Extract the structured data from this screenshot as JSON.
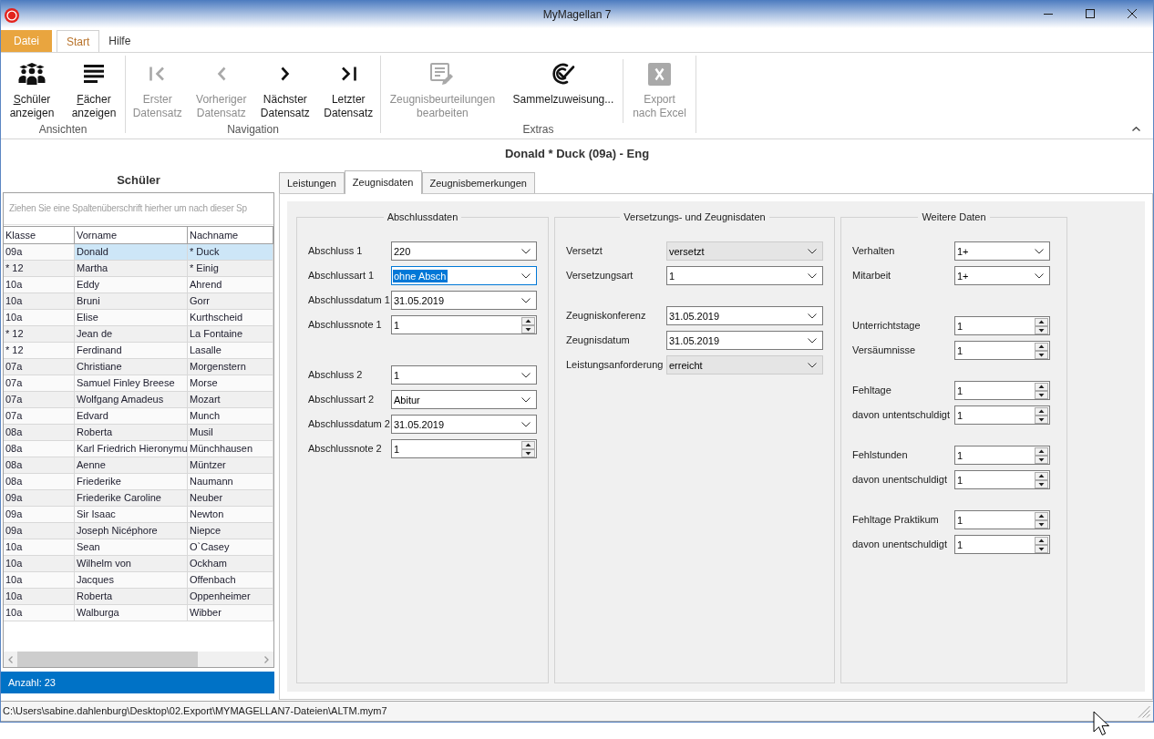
{
  "window": {
    "title": "MyMagellan 7"
  },
  "ribbon_tabs": [
    {
      "label": "Datei",
      "kind": "file",
      "selected": false
    },
    {
      "label": "Start",
      "kind": "tab",
      "selected": true
    },
    {
      "label": "Hilfe",
      "kind": "tab",
      "selected": false
    }
  ],
  "ribbon_groups": [
    {
      "label": "Ansichten",
      "sections": [
        {
          "buttons": [
            {
              "lines": [
                "Schüler",
                "anzeigen"
              ],
              "disabled": false,
              "access_key_underlined": true
            },
            {
              "lines": [
                "Fächer",
                "anzeigen"
              ],
              "disabled": false,
              "access_key_underlined": true
            }
          ]
        }
      ]
    },
    {
      "label": "Navigation",
      "sections": [
        {
          "buttons": [
            {
              "lines": [
                "Erster",
                "Datensatz"
              ],
              "disabled": true,
              "access_key_underlined": false
            },
            {
              "lines": [
                "Vorheriger",
                "Datensatz"
              ],
              "disabled": true,
              "access_key_underlined": false
            },
            {
              "lines": [
                "Nächster",
                "Datensatz"
              ],
              "disabled": false,
              "access_key_underlined": false
            },
            {
              "lines": [
                "Letzter",
                "Datensatz"
              ],
              "disabled": false,
              "access_key_underlined": false
            }
          ]
        }
      ]
    },
    {
      "label": "Extras",
      "sections": [
        {
          "buttons": [
            {
              "lines": [
                "Zeugnisbeurteilungen",
                "bearbeiten"
              ],
              "disabled": true,
              "access_key_underlined": false
            },
            {
              "lines": [
                "Sammelzuweisung..."
              ],
              "disabled": false,
              "access_key_underlined": false
            }
          ]
        },
        {
          "buttons": [
            {
              "lines": [
                "Export",
                "nach Excel"
              ],
              "disabled": true,
              "access_key_underlined": false
            }
          ]
        }
      ]
    }
  ],
  "record": {
    "title": "Donald * Duck (09a) - Eng"
  },
  "student_list": {
    "title": "Schüler",
    "group_hint": "Ziehen Sie eine Spaltenüberschrift hierher um nach dieser Sp",
    "columns": [
      "Klasse",
      "Vorname",
      "Nachname"
    ],
    "rows": [
      {
        "cells": [
          "09a",
          "Donald",
          "* Duck"
        ],
        "selected": true
      },
      {
        "cells": [
          "* 12",
          "Martha",
          "* Einig"
        ],
        "selected": false
      },
      {
        "cells": [
          "10a",
          "Eddy",
          "Ahrend"
        ],
        "selected": false
      },
      {
        "cells": [
          "10a",
          "Bruni",
          "Gorr"
        ],
        "selected": false
      },
      {
        "cells": [
          "10a",
          "Elise",
          "Kurthscheid"
        ],
        "selected": false
      },
      {
        "cells": [
          "* 12",
          "Jean de",
          "La Fontaine"
        ],
        "selected": false
      },
      {
        "cells": [
          "* 12",
          "Ferdinand",
          "Lasalle"
        ],
        "selected": false
      },
      {
        "cells": [
          "07a",
          "Christiane",
          "Morgenstern"
        ],
        "selected": false
      },
      {
        "cells": [
          "07a",
          "Samuel Finley Breese",
          "Morse"
        ],
        "selected": false
      },
      {
        "cells": [
          "07a",
          "Wolfgang Amadeus",
          "Mozart"
        ],
        "selected": false
      },
      {
        "cells": [
          "07a",
          "Edvard",
          "Munch"
        ],
        "selected": false
      },
      {
        "cells": [
          "08a",
          "Roberta",
          "Musil"
        ],
        "selected": false
      },
      {
        "cells": [
          "08a",
          "Karl Friedrich Hieronymu",
          "Münchhausen"
        ],
        "selected": false
      },
      {
        "cells": [
          "08a",
          "Aenne",
          "Müntzer"
        ],
        "selected": false
      },
      {
        "cells": [
          "08a",
          "Friederike",
          "Naumann"
        ],
        "selected": false
      },
      {
        "cells": [
          "09a",
          "Friederike Caroline",
          "Neuber"
        ],
        "selected": false
      },
      {
        "cells": [
          "09a",
          "Sir Isaac",
          "Newton"
        ],
        "selected": false
      },
      {
        "cells": [
          "09a",
          "Joseph Nicéphore",
          "Niepce"
        ],
        "selected": false
      },
      {
        "cells": [
          "10a",
          "Sean",
          "O`Casey"
        ],
        "selected": false
      },
      {
        "cells": [
          "10a",
          "Wilhelm von",
          "Ockham"
        ],
        "selected": false
      },
      {
        "cells": [
          "10a",
          "Jacques",
          "Offenbach"
        ],
        "selected": false
      },
      {
        "cells": [
          "10a",
          "Roberta",
          "Oppenheimer"
        ],
        "selected": false
      },
      {
        "cells": [
          "10a",
          "Walburga",
          "Wibber"
        ],
        "selected": false
      }
    ],
    "count": "Anzahl: 23"
  },
  "form_tabs": [
    {
      "label": "Leistungen",
      "selected": false
    },
    {
      "label": "Zeugnisdaten",
      "selected": true
    },
    {
      "label": "Zeugnisbemerkungen",
      "selected": false
    }
  ],
  "form_groups": [
    {
      "title": "Abschlussdaten",
      "sections": [
        {
          "fields": [
            {
              "label": "Abschluss 1",
              "value": "220",
              "kind": "combo",
              "disabled": false,
              "focused": false
            },
            {
              "label": "Abschlussart 1",
              "value": "ohne Absch",
              "kind": "combo",
              "disabled": false,
              "focused": true
            },
            {
              "label": "Abschlussdatum 1",
              "value": "31.05.2019",
              "kind": "combo",
              "disabled": false,
              "focused": false
            },
            {
              "label": "Abschlussnote 1",
              "value": "1",
              "kind": "spin",
              "disabled": false,
              "focused": false
            }
          ]
        },
        {
          "fields": [
            {
              "label": "Abschluss 2",
              "value": "1",
              "kind": "combo",
              "disabled": false,
              "focused": false
            },
            {
              "label": "Abschlussart 2",
              "value": "Abitur",
              "kind": "combo",
              "disabled": false,
              "focused": false
            },
            {
              "label": "Abschlussdatum 2",
              "value": "31.05.2019",
              "kind": "combo",
              "disabled": false,
              "focused": false
            },
            {
              "label": "Abschlussnote 2",
              "value": "1",
              "kind": "spin",
              "disabled": false,
              "focused": false
            }
          ]
        }
      ]
    },
    {
      "title": "Versetzungs- und Zeugnisdaten",
      "sections": [
        {
          "fields": [
            {
              "label": "Versetzt",
              "value": "versetzt",
              "kind": "combo",
              "disabled": true,
              "focused": false
            },
            {
              "label": "Versetzungsart",
              "value": "1",
              "kind": "combo",
              "disabled": false,
              "focused": false
            }
          ]
        },
        {
          "fields": [
            {
              "label": "Zeugniskonferenz",
              "value": "31.05.2019",
              "kind": "combo",
              "disabled": false,
              "focused": false
            },
            {
              "label": "Zeugnisdatum",
              "value": "31.05.2019",
              "kind": "combo",
              "disabled": false,
              "focused": false
            },
            {
              "label": "Leistungsanforderung",
              "value": "erreicht",
              "kind": "combo",
              "disabled": true,
              "focused": false
            }
          ]
        }
      ]
    },
    {
      "title": "Weitere Daten",
      "sections": [
        {
          "fields": [
            {
              "label": "Verhalten",
              "value": "1+",
              "kind": "combo",
              "disabled": false,
              "focused": false
            },
            {
              "label": "Mitarbeit",
              "value": "1+",
              "kind": "combo",
              "disabled": false,
              "focused": false
            }
          ]
        },
        {
          "fields": [
            {
              "label": "Unterrichtstage",
              "value": "1",
              "kind": "spin",
              "disabled": false,
              "focused": false
            },
            {
              "label": "Versäumnisse",
              "value": "1",
              "kind": "spin",
              "disabled": false,
              "focused": false
            }
          ]
        },
        {
          "fields": [
            {
              "label": "Fehltage",
              "value": "1",
              "kind": "spin",
              "disabled": false,
              "focused": false
            },
            {
              "label": "davon untentschuldigt",
              "value": "1",
              "kind": "spin",
              "disabled": false,
              "focused": false
            }
          ]
        },
        {
          "fields": [
            {
              "label": "Fehlstunden",
              "value": "1",
              "kind": "spin",
              "disabled": false,
              "focused": false
            },
            {
              "label": "davon unentschuldigt",
              "value": "1",
              "kind": "spin",
              "disabled": false,
              "focused": false
            }
          ]
        },
        {
          "fields": [
            {
              "label": "Fehltage Praktikum",
              "value": "1",
              "kind": "spin",
              "disabled": false,
              "focused": false
            },
            {
              "label": "davon unentschuldigt",
              "value": "1",
              "kind": "spin",
              "disabled": false,
              "focused": false
            }
          ]
        }
      ]
    }
  ],
  "status_bar": {
    "path": "C:\\Users\\sabine.dahlenburg\\Desktop\\02.Export\\MYMAGELLAN7-Dateien\\ALTM.mym7"
  }
}
